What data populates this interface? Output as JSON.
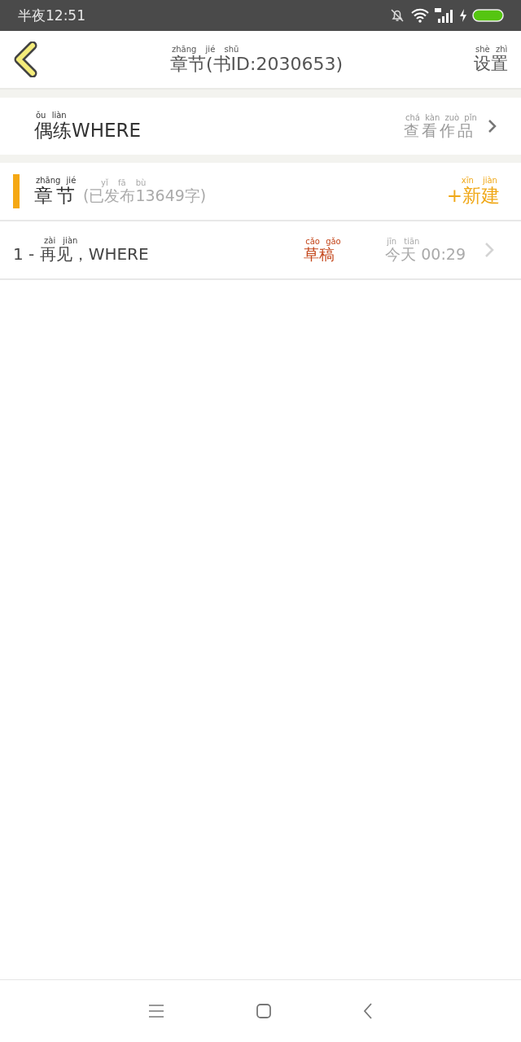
{
  "status_bar": {
    "time": "半夜12:51"
  },
  "header": {
    "title": "章节(书ID:2030653)",
    "title_pinyin": "zhāng jié shū",
    "settings": "设置",
    "settings_pinyin": "shè zhì"
  },
  "book": {
    "name": "偶练WHERE",
    "name_pinyin": "ǒu liàn",
    "link": "查看作品",
    "link_pinyin": "chá kàn zuò pǐn"
  },
  "chapters_header": {
    "label": "章节",
    "label_pinyin": "zhāng jié",
    "count": "(已发布13649字)",
    "count_pinyin": "yǐ fā bù",
    "new_button": "+新建",
    "new_button_pinyin": "xīn jiàn"
  },
  "chapters": [
    {
      "title": "1 - 再见，WHERE",
      "title_pinyin": "zài jiàn",
      "status": "草稿",
      "status_pinyin": "cǎo gǎo",
      "time": "今天 00:29",
      "time_pinyin": "jīn tiān"
    }
  ]
}
